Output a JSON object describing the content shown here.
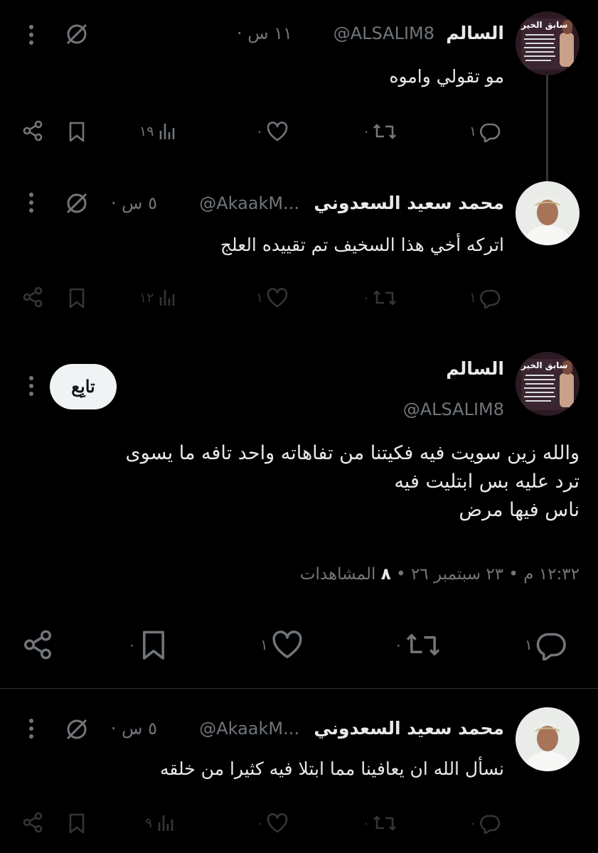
{
  "tweets": [
    {
      "name": "السالم",
      "handle": "@ALSALIM8",
      "time": "١١ س",
      "text": "مو تقولي واموه",
      "replies": "١",
      "retweets": "٠",
      "likes": "٠",
      "views": "١٩"
    },
    {
      "name": "محمد سعيد السعدوني",
      "handle": "@AkaakM...",
      "time": "٥ س",
      "text": "اتركه أخي هذا السخيف تم تقييده العلج",
      "replies": "١",
      "retweets": "٠",
      "likes": "١",
      "views": "١٢"
    },
    {
      "name": "محمد سعيد السعدوني",
      "handle": "@AkaakM...",
      "time": "٥ س",
      "text": "نسأل الله ان يعافينا مما ابتلا فيه كثيرا من خلقه",
      "replies": "٠",
      "retweets": "٠",
      "likes": "٠",
      "views": "٩"
    }
  ],
  "main": {
    "name": "السالم",
    "handle": "@ALSALIM8",
    "follow_label": "تابِع",
    "text_lines": [
      "والله زين سويت فيه فكيتنا من تفاهاته واحد تافه ما يسوى",
      "ترد عليه بس ابتليت فيه",
      "ناس فيها مرض"
    ],
    "timestamp": "١٢:٣٢ م • ٢٣ سبتمبر ٢٦ •",
    "views_count": "٨",
    "views_label": "المشاهدات",
    "replies": "١",
    "retweets": "٠",
    "likes": "١",
    "bookmarks": "٠"
  },
  "avatar_banner_text": "سابق الخير",
  "icons": [
    "more-icon",
    "grok-icon",
    "reply-icon",
    "retweet-icon",
    "like-icon",
    "views-icon",
    "bookmark-icon",
    "share-icon"
  ]
}
